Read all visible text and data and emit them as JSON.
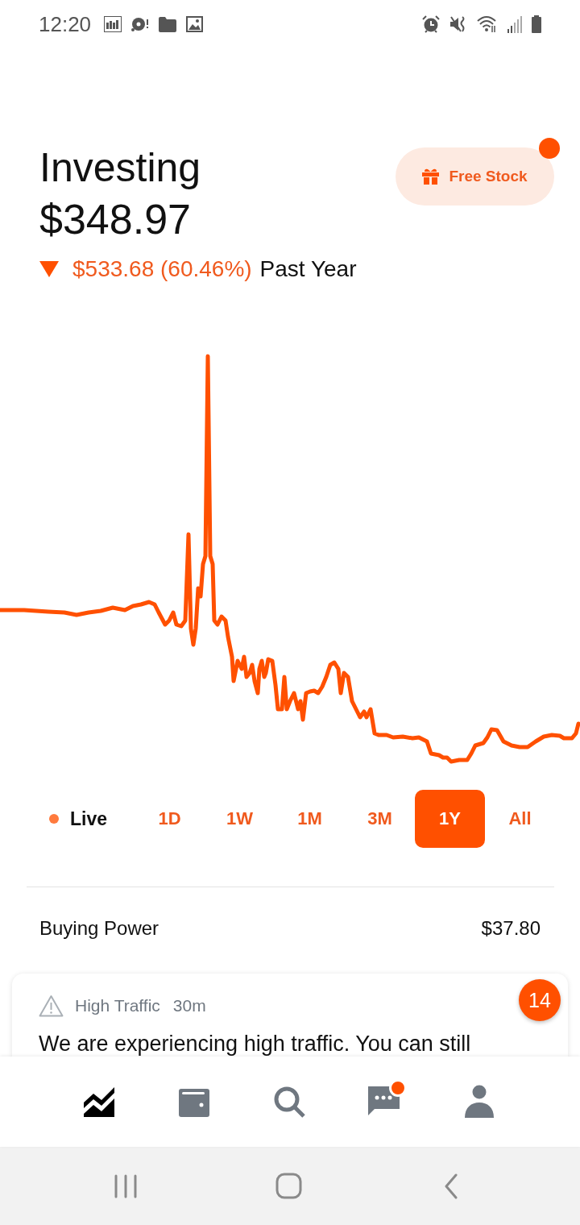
{
  "status_bar": {
    "time": "12:20"
  },
  "header": {
    "title": "Investing",
    "value": "$348.97",
    "change": {
      "negative": true,
      "amount": "$533.68 (60.46%)",
      "period": "Past Year"
    }
  },
  "free_stock_button": {
    "label": "Free Stock",
    "notification_dot": true
  },
  "range_selector": {
    "live": {
      "label": "Live"
    },
    "ranges": [
      {
        "label": "1D",
        "selected": false
      },
      {
        "label": "1W",
        "selected": false
      },
      {
        "label": "1M",
        "selected": false
      },
      {
        "label": "3M",
        "selected": false
      },
      {
        "label": "1Y",
        "selected": true
      },
      {
        "label": "All",
        "selected": false
      }
    ]
  },
  "buying_power": {
    "label": "Buying Power",
    "value": "$37.80"
  },
  "notification_card": {
    "title": "High Traffic",
    "time": "30m",
    "body": "We are experiencing high traffic. You can still",
    "badge": "14"
  },
  "bottom_nav": {
    "items": [
      {
        "kind": "portfolio",
        "selected": true,
        "notification_dot": false
      },
      {
        "kind": "wallet",
        "selected": false,
        "notification_dot": false
      },
      {
        "kind": "search",
        "selected": false,
        "notification_dot": false
      },
      {
        "kind": "messages",
        "selected": false,
        "notification_dot": true
      },
      {
        "kind": "account",
        "selected": false,
        "notification_dot": false
      }
    ]
  }
}
